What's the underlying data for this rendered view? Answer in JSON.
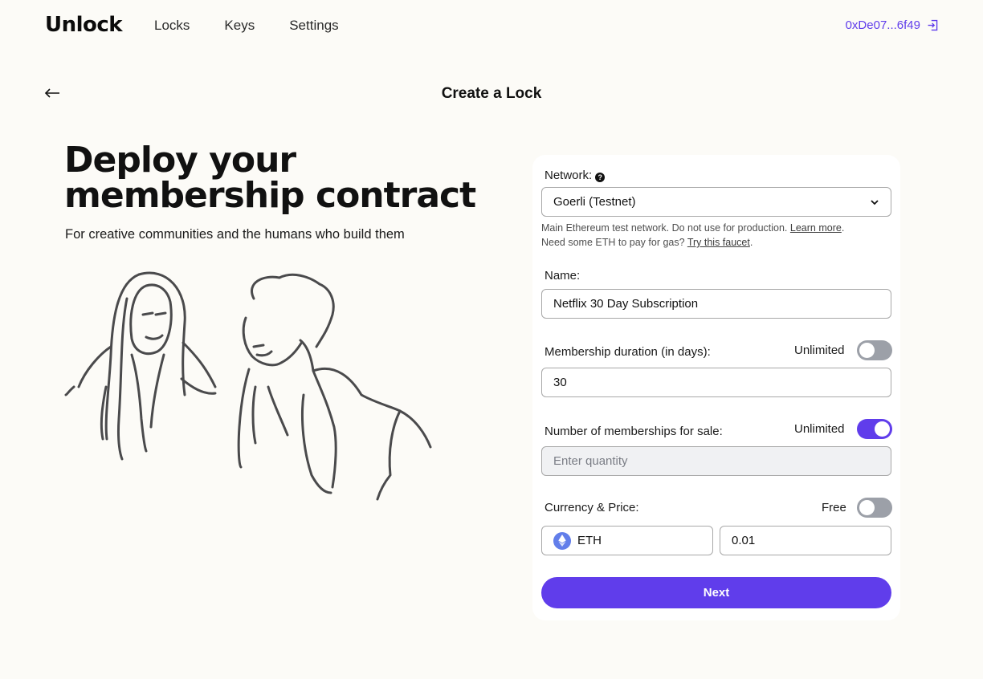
{
  "brand": {
    "logo_text": "Unlock"
  },
  "nav": {
    "items": [
      {
        "label": "Locks"
      },
      {
        "label": "Keys"
      },
      {
        "label": "Settings"
      }
    ]
  },
  "wallet": {
    "address": "0xDe07...6f49",
    "icon": "logout-icon"
  },
  "page": {
    "title": "Create a Lock"
  },
  "hero": {
    "title_line1": "Deploy your",
    "title_line2": "membership contract",
    "subtitle": "For creative communities and the humans who build them"
  },
  "form": {
    "network": {
      "label": "Network:",
      "value": "Goerli (Testnet)",
      "hint_line1": "Main Ethereum test network. Do not use for production.",
      "hint_link1": "Learn more",
      "hint_line2": "Need some ETH to pay for gas?",
      "hint_link2": "Try this faucet"
    },
    "name": {
      "label": "Name:",
      "value": "Netflix 30 Day Subscription"
    },
    "duration": {
      "label": "Membership duration (in days):",
      "toggle_label": "Unlimited",
      "toggle_on": false,
      "value": "30"
    },
    "quantity": {
      "label": "Number of memberships for sale:",
      "toggle_label": "Unlimited",
      "toggle_on": true,
      "placeholder": "Enter quantity"
    },
    "price": {
      "label": "Currency & Price:",
      "toggle_label": "Free",
      "toggle_on": false,
      "currency": "ETH",
      "value": "0.01"
    },
    "submit_label": "Next"
  },
  "colors": {
    "accent": "#603DEB",
    "background": "#FCFBF7",
    "eth": "#627EEA"
  }
}
